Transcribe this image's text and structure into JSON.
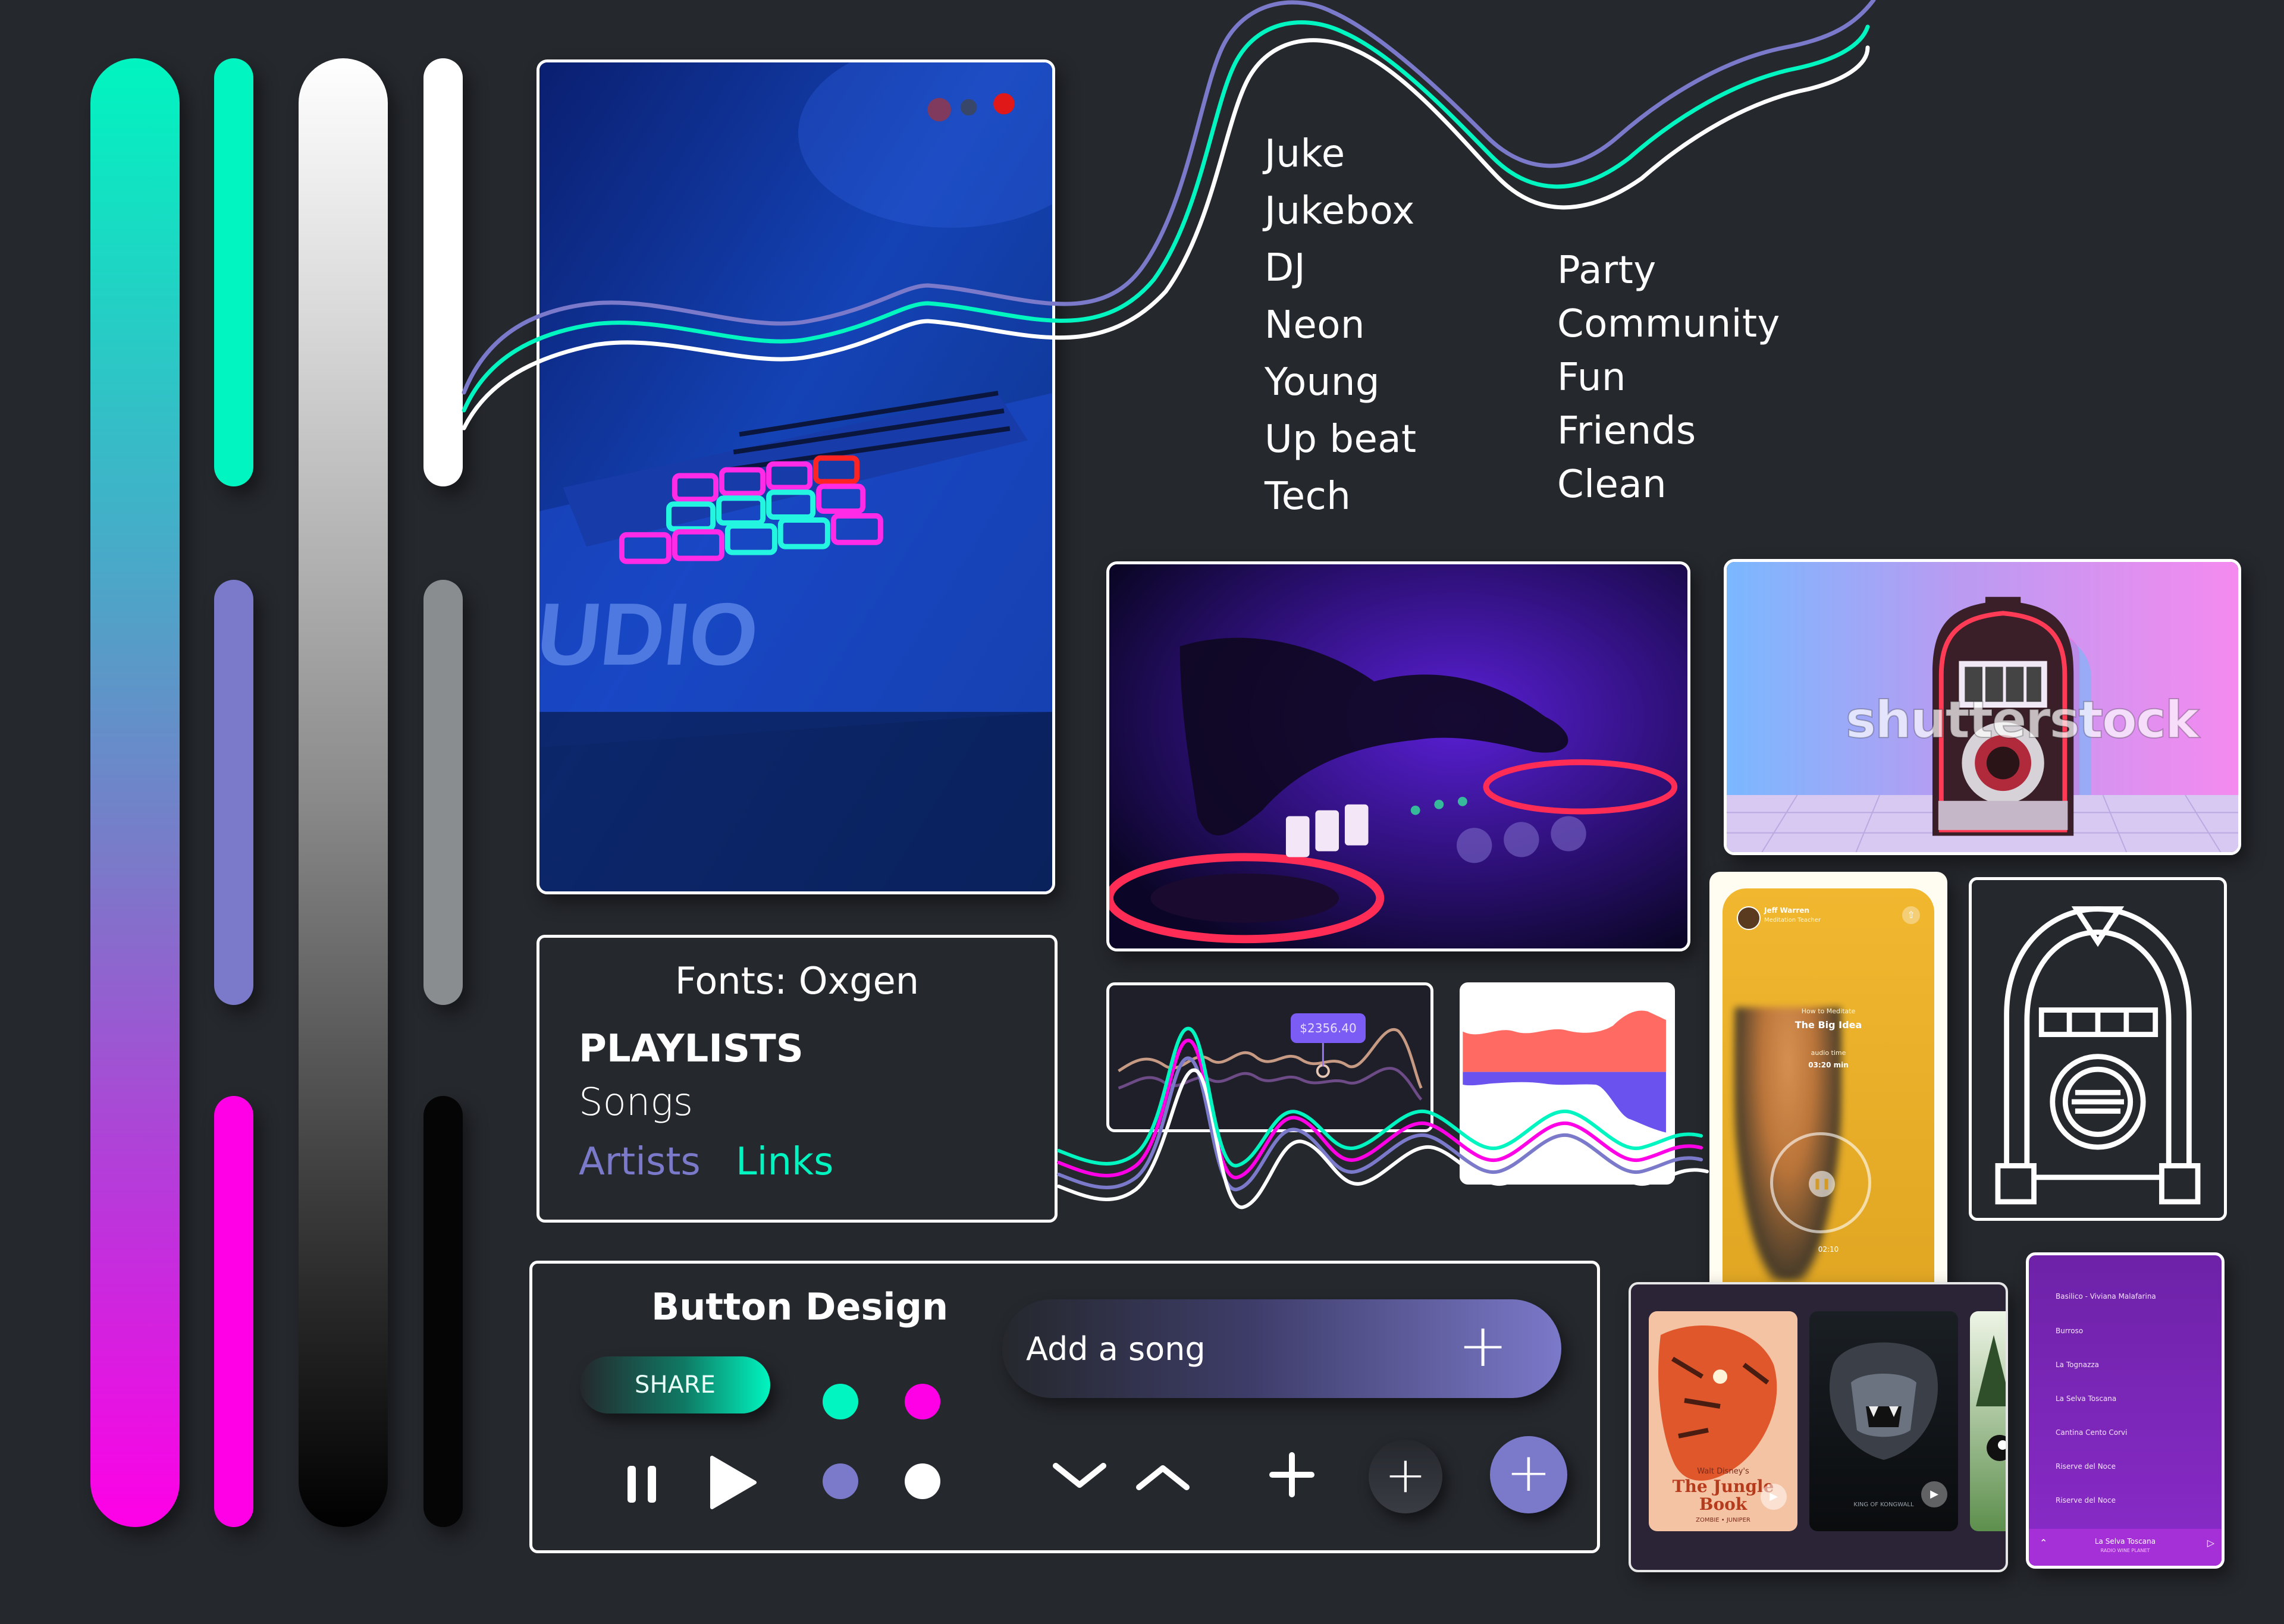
{
  "palette": {
    "background": "#25282d",
    "teal": "#00f5c0",
    "purple": "#7b79c9",
    "magenta": "#ff00e6",
    "white": "#ffffff",
    "gray": "#898d90",
    "black": "#050505"
  },
  "keywords": {
    "left": [
      "Juke",
      "Jukebox",
      "DJ",
      "Neon",
      "Young",
      "Up beat",
      "Tech"
    ],
    "right": [
      "Party",
      "Community",
      "Fun",
      "Friends",
      "Clean"
    ]
  },
  "fonts": {
    "title": "Fonts: Oxgen",
    "heading": "PLAYLISTS",
    "body": "Songs",
    "link1": "Artists",
    "link2": "Links"
  },
  "buttons": {
    "title": "Button Design",
    "share": "SHARE",
    "add_song": "Add a song",
    "icons": [
      "pause-icon",
      "play-icon",
      "chevron-down-icon",
      "chevron-up-icon",
      "plus-icon"
    ]
  },
  "chart_card": {
    "price_tag": "$2356.40"
  },
  "meditation_card": {
    "user_name": "Jeff Warren",
    "user_role": "Meditation Teacher",
    "eyebrow": "How to Meditate",
    "title": "The Big Idea",
    "time_label": "audio time",
    "duration": "03:20 min",
    "elapsed": "02:10"
  },
  "movie_card": {
    "poster1_subtitle": "Walt Disney's",
    "poster1_title": "The Jungle Book",
    "poster1_credit": "ZOMBIE • JUNIPER",
    "poster2_credit": "KING OF KONGWALL"
  },
  "playlist_card": {
    "songs": [
      "Basilico - Viviana Malafarina",
      "Burroso",
      "La Tognazza",
      "La Selva Toscana",
      "Cantina Cento Corvi",
      "Riserve del Noce",
      "Riserve del Noce"
    ],
    "now_playing_title": "La Selva Toscana",
    "now_playing_sub": "RADIO WINE PLANET"
  },
  "watermark": "shutterstock"
}
